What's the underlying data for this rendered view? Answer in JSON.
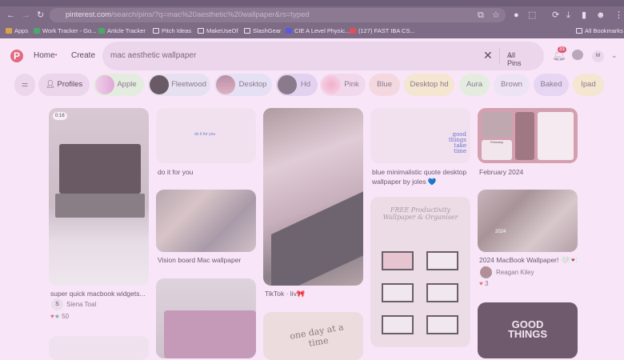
{
  "browser": {
    "url_host": "pinterest.com",
    "url_path": "/search/pins/?q=mac%20aesthetic%20wallpaper&rs=typed",
    "bookmarks": [
      {
        "label": "Apps",
        "color": "#d9a24a"
      },
      {
        "label": "Work Tracker - Go...",
        "color": "#4aa86a"
      },
      {
        "label": "Article Tracker",
        "color": "#4aa86a"
      },
      {
        "label": "Pitch Ideas",
        "color": "#cbbad0"
      },
      {
        "label": "MakeUseOf",
        "color": "#cbbad0"
      },
      {
        "label": "SlashGear",
        "color": "#cbbad0"
      },
      {
        "label": "CIE A Level Physic...",
        "color": "#5a5ae0"
      },
      {
        "label": "(127) FAST IBA CS...",
        "color": "#e0505a"
      }
    ],
    "all_bookmarks": "All Bookmarks"
  },
  "header": {
    "home": "Home",
    "create": "Create",
    "search_value": "mac aesthetic wallpaper",
    "filter": "All Pins",
    "notifications": "33",
    "avatar": "M"
  },
  "chips": [
    {
      "label": "Profiles"
    },
    {
      "label": "Apple"
    },
    {
      "label": "Fleetwood"
    },
    {
      "label": "Desktop"
    },
    {
      "label": "Hd"
    },
    {
      "label": "Pink"
    },
    {
      "label": "Blue"
    },
    {
      "label": "Desktop hd"
    },
    {
      "label": "Aura"
    },
    {
      "label": "Brown"
    },
    {
      "label": "Baked"
    },
    {
      "label": "Ipad"
    }
  ],
  "pins": {
    "p1": {
      "badge": "0:16",
      "title": "super quick macbook widgets...",
      "author": "Siena Toal",
      "initial": "S",
      "reactions": "50"
    },
    "p2": {
      "title": "do it for you",
      "image_text": "do it for you"
    },
    "p3": {
      "title": "Vision board Mac wallpaper"
    },
    "p4": {
      "title": "TikTok · liv🎀"
    },
    "p5": {
      "image_text": "one day at a time"
    },
    "p6": {
      "title": "blue minimalistic quote desktop wallpaper by joles 💙",
      "image_text": "good things take time"
    },
    "p7": {
      "image_text": "FREE Productivity Wallpaper & Organiser"
    },
    "p8": {
      "title": "February 2024",
      "image_text": "February"
    },
    "p9": {
      "title": "2024 MacBook Wallpaper! 🤍💌🤞",
      "author": "Reagan Kiley",
      "reactions": "3",
      "image_text": "2024"
    },
    "p10": {
      "image_text": "GOOD THINGS"
    }
  }
}
